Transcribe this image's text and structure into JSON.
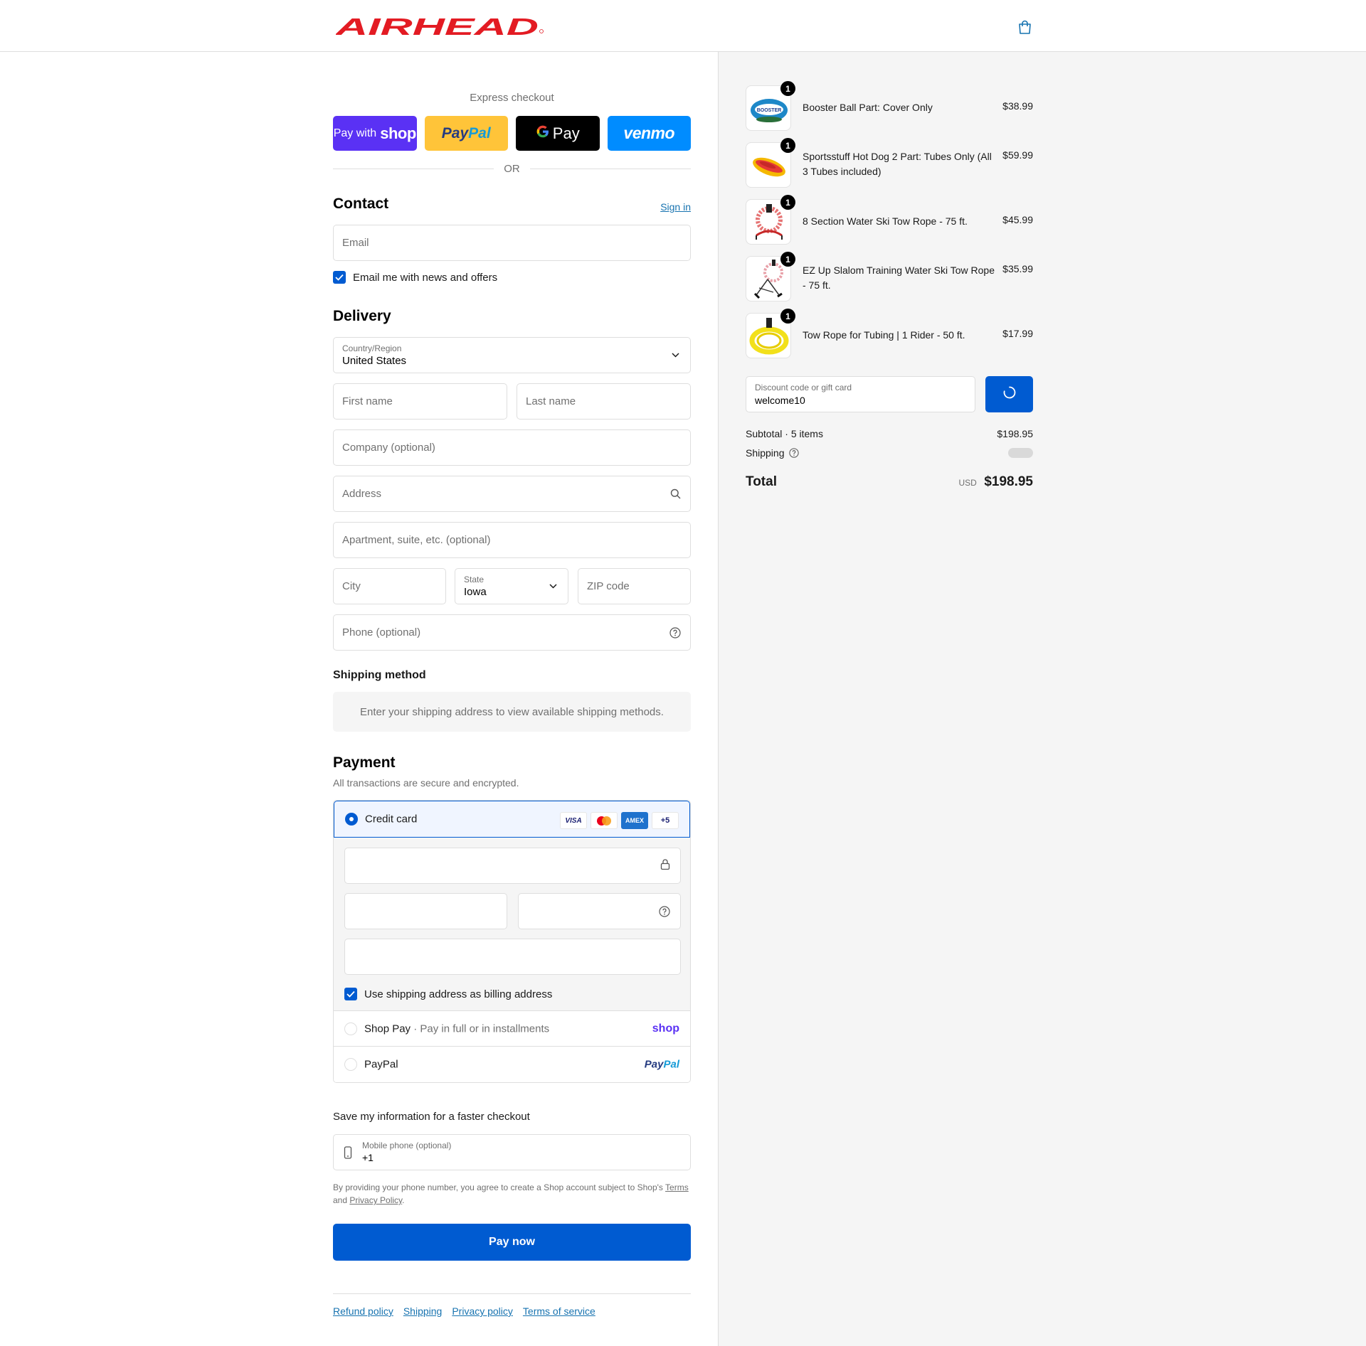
{
  "brand": {
    "logo_text": "AIRHEAD",
    "accent": "#005bd1",
    "logo_color": "#e31b23"
  },
  "header": {
    "cart_icon": "shopping-bag-icon"
  },
  "express": {
    "title": "Express checkout",
    "shop_pay_prefix": "Pay with",
    "shop_pay_word": "shop",
    "paypal_a": "Pay",
    "paypal_b": "Pal",
    "gpay_label": "Pay",
    "venmo_label": "venmo",
    "or_text": "OR"
  },
  "contact": {
    "heading": "Contact",
    "sign_in": "Sign in",
    "email_placeholder": "Email",
    "news_label": "Email me with news and offers"
  },
  "delivery": {
    "heading": "Delivery",
    "country_label": "Country/Region",
    "country_value": "United States",
    "first_name": "First name",
    "last_name": "Last name",
    "company": "Company (optional)",
    "address": "Address",
    "apartment": "Apartment, suite, etc. (optional)",
    "city": "City",
    "state_label": "State",
    "state_value": "Iowa",
    "zip": "ZIP code",
    "phone": "Phone (optional)"
  },
  "shipping_method": {
    "heading": "Shipping method",
    "info": "Enter your shipping address to view available shipping methods."
  },
  "payment": {
    "heading": "Payment",
    "subtitle": "All transactions are secure and encrypted.",
    "credit_card": "Credit card",
    "cards": [
      "VISA",
      "AMEX",
      "+5"
    ],
    "billing_label": "Use shipping address as billing address",
    "shop_pay": "Shop Pay",
    "shop_pay_sub": "Pay in full or in installments",
    "shop_logo": "shop",
    "paypal": "PayPal",
    "paypal_logo_a": "Pay",
    "paypal_logo_b": "Pal"
  },
  "save_info": {
    "heading": "Save my information for a faster checkout",
    "mobile_label": "Mobile phone (optional)",
    "mobile_value": "+1",
    "fine_prefix": "By providing your phone number, you agree to create a Shop account subject to Shop's",
    "fine_terms": "Terms",
    "fine_and": "and",
    "fine_privacy": "Privacy Policy",
    "fine_end": "."
  },
  "pay_now": "Pay now",
  "footer_links": [
    "Refund policy",
    "Shipping",
    "Privacy policy",
    "Terms of service"
  ],
  "order": {
    "items": [
      {
        "name": "Booster Ball Part: Cover Only",
        "price": "$38.99",
        "qty": "1"
      },
      {
        "name": "Sportsstuff Hot Dog 2 Part: Tubes Only (All 3 Tubes included)",
        "price": "$59.99",
        "qty": "1"
      },
      {
        "name": "8 Section Water Ski Tow Rope - 75 ft.",
        "price": "$45.99",
        "qty": "1"
      },
      {
        "name": "EZ Up Slalom Training Water Ski Tow Rope - 75 ft.",
        "price": "$35.99",
        "qty": "1"
      },
      {
        "name": "Tow Rope for Tubing | 1 Rider - 50 ft.",
        "price": "$17.99",
        "qty": "1"
      }
    ],
    "discount_label": "Discount code or gift card",
    "discount_value": "welcome10",
    "subtotal_label": "Subtotal · 5 items",
    "subtotal_value": "$198.95",
    "shipping_label": "Shipping",
    "total_label": "Total",
    "currency": "USD",
    "total_value": "$198.95"
  }
}
